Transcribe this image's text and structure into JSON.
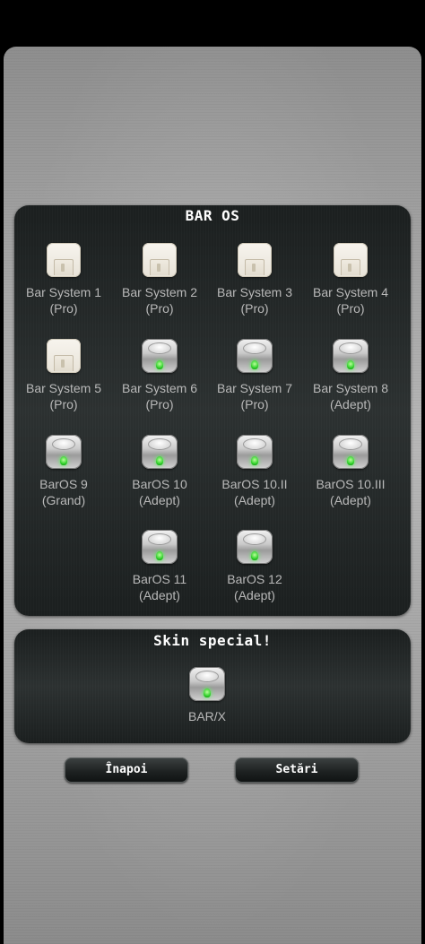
{
  "colors": {
    "panel_background": "#222727",
    "item_label": "#b9b9b9",
    "title_text": "#ffffff",
    "led_green": "#2fd12a"
  },
  "main_panel": {
    "title": "BAR OS",
    "items": [
      {
        "name": "Bar System 1",
        "edition": "(Pro)",
        "icon": "floppy-disk-icon"
      },
      {
        "name": "Bar System 2",
        "edition": "(Pro)",
        "icon": "floppy-disk-icon"
      },
      {
        "name": "Bar System 3",
        "edition": "(Pro)",
        "icon": "floppy-disk-icon"
      },
      {
        "name": "Bar System 4",
        "edition": "(Pro)",
        "icon": "floppy-disk-icon"
      },
      {
        "name": "Bar System 5",
        "edition": "(Pro)",
        "icon": "floppy-disk-icon"
      },
      {
        "name": "Bar System 6",
        "edition": "(Pro)",
        "icon": "hard-drive-icon"
      },
      {
        "name": "Bar System 7",
        "edition": "(Pro)",
        "icon": "hard-drive-icon"
      },
      {
        "name": "Bar System 8",
        "edition": "(Adept)",
        "icon": "hard-drive-icon"
      },
      {
        "name": "BarOS 9",
        "edition": "(Grand)",
        "icon": "hard-drive-icon"
      },
      {
        "name": "BarOS 10",
        "edition": "(Adept)",
        "icon": "hard-drive-icon"
      },
      {
        "name": "BarOS 10.II",
        "edition": "(Adept)",
        "icon": "hard-drive-icon"
      },
      {
        "name": "BarOS 10.III",
        "edition": "(Adept)",
        "icon": "hard-drive-icon"
      },
      {
        "name": "BarOS 11",
        "edition": "(Adept)",
        "icon": "hard-drive-icon"
      },
      {
        "name": "BarOS 12",
        "edition": "(Adept)",
        "icon": "hard-drive-icon"
      }
    ]
  },
  "special_panel": {
    "title": "Skin special!",
    "item": {
      "name": "BAR/X",
      "icon": "hard-drive-icon"
    }
  },
  "buttons": {
    "back": "Înapoi",
    "settings": "Setări"
  }
}
